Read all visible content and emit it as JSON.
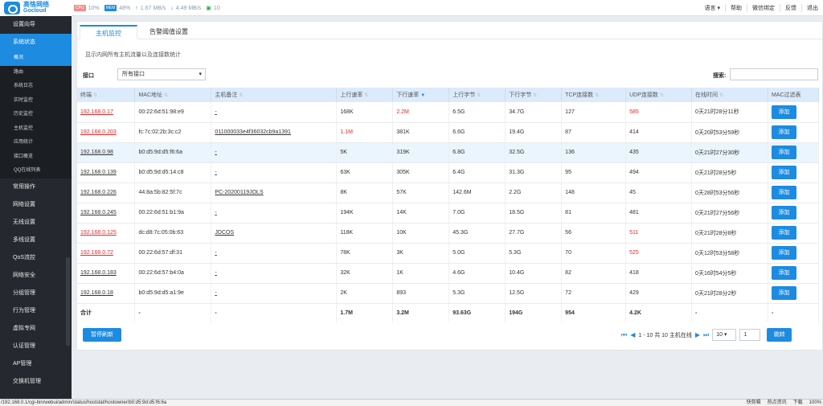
{
  "logo": {
    "cn": "高恪网络",
    "en": "Gocloud"
  },
  "stats": {
    "cpu": "10%",
    "mem": "48%",
    "up": "1.67 MB/s",
    "down": "4.49 MB/s",
    "online": "10"
  },
  "topnav": [
    "语言 ▾",
    "帮助",
    "微信绑定",
    "反馈",
    "退出"
  ],
  "sidebar": {
    "items_before": [
      "设置向导",
      "系统状态"
    ],
    "sub": [
      "概况",
      "路由",
      "系统日志",
      "实时监控",
      "历史监控",
      "主机监控",
      "应用统计",
      "接口概览",
      "QQ在线列表"
    ],
    "items_after": [
      "常用操作",
      "网络设置",
      "无线设置",
      "多线设置",
      "QoS流控",
      "网络安全",
      "分组管理",
      "行为管理",
      "虚拟专网",
      "认证管理",
      "AP管理",
      "交换机管理"
    ]
  },
  "tabs": [
    "主机监控",
    "告警阈值设置"
  ],
  "hint": "显示内网所有主机流量以及连接数统计",
  "filter": {
    "label": "接口",
    "value": "所有接口"
  },
  "search": {
    "label": "搜索:"
  },
  "columns": [
    "终端",
    "MAC地址",
    "主机备注",
    "上行速率",
    "下行速率",
    "上行字节",
    "下行字节",
    "TCP连接数",
    "UDP连接数",
    "在线时间",
    "MAC过滤表"
  ],
  "rows": [
    {
      "ip": "192.168.0.17",
      "mac": "00:22:6d:51:98:e9",
      "note": "-",
      "up": "168K",
      "down": "2.2M",
      "ub": "6.5G",
      "db": "34.7G",
      "tcp": "127",
      "udp": "585",
      "time": "0天21时28分11秒",
      "ip_red": true,
      "up_red": false,
      "down_red": true,
      "udp_red": true
    },
    {
      "ip": "192.168.0.203",
      "mac": "fc:7c:02:2b:3c:c2",
      "note": "011000033e4f36032cb9a1391",
      "up": "1.1M",
      "down": "381K",
      "ub": "6.6G",
      "db": "19.4G",
      "tcp": "87",
      "udp": "414",
      "time": "0天20时53分59秒",
      "ip_red": true,
      "up_red": true,
      "down_red": false,
      "udp_red": false
    },
    {
      "ip": "192.168.0.98",
      "mac": "b0:d5:9d:d5:f6:6a",
      "note": "-",
      "up": "5K",
      "down": "319K",
      "ub": "6.8G",
      "db": "32.5G",
      "tcp": "136",
      "udp": "435",
      "time": "0天21时27分30秒",
      "ip_red": false,
      "up_red": false,
      "down_red": false,
      "udp_red": false
    },
    {
      "ip": "192.168.0.139",
      "mac": "b0:d5:9d:d5:14:c8",
      "note": "-",
      "up": "63K",
      "down": "305K",
      "ub": "6.4G",
      "db": "31.3G",
      "tcp": "95",
      "udp": "494",
      "time": "0天21时28分5秒",
      "ip_red": false,
      "up_red": false,
      "down_red": false,
      "udp_red": false
    },
    {
      "ip": "192.168.0.226",
      "mac": "44:8a:5b:82:5f:7c",
      "note": "PC-20200119JOLS",
      "up": "8K",
      "down": "57K",
      "ub": "142.6M",
      "db": "2.2G",
      "tcp": "148",
      "udp": "45",
      "time": "0天28时53分56秒",
      "ip_red": false,
      "up_red": false,
      "down_red": false,
      "udp_red": false
    },
    {
      "ip": "192.168.0.245",
      "mac": "00:22:6d:51:b1:9a",
      "note": "-",
      "up": "194K",
      "down": "14K",
      "ub": "7.0G",
      "db": "18.5G",
      "tcp": "81",
      "udp": "481",
      "time": "0天21时27分56秒",
      "ip_red": false,
      "up_red": false,
      "down_red": false,
      "udp_red": false
    },
    {
      "ip": "192.168.0.125",
      "mac": "dc:d8:7c:05:0b:63",
      "note": "JDCOS",
      "up": "118K",
      "down": "10K",
      "ub": "45.3G",
      "db": "27.7G",
      "tcp": "56",
      "udp": "511",
      "time": "0天21时28分8秒",
      "ip_red": true,
      "up_red": false,
      "down_red": false,
      "udp_red": true
    },
    {
      "ip": "192.168.0.72",
      "mac": "00:22:6d:57:df:31",
      "note": "-",
      "up": "78K",
      "down": "3K",
      "ub": "5.0G",
      "db": "5.3G",
      "tcp": "70",
      "udp": "525",
      "time": "0天12时53分58秒",
      "ip_red": true,
      "up_red": false,
      "down_red": false,
      "udp_red": true
    },
    {
      "ip": "192.168.0.183",
      "mac": "00:22:6d:57:b4:0a",
      "note": "-",
      "up": "32K",
      "down": "1K",
      "ub": "4.6G",
      "db": "10.4G",
      "tcp": "82",
      "udp": "418",
      "time": "0天16时54分5秒",
      "ip_red": false,
      "up_red": false,
      "down_red": false,
      "udp_red": false
    },
    {
      "ip": "192.168.0.18",
      "mac": "b0:d5:9d:d5:a1:9e",
      "note": "-",
      "up": "2K",
      "down": "893",
      "ub": "5.3G",
      "db": "12.5G",
      "tcp": "72",
      "udp": "429",
      "time": "0天21时28分2秒",
      "ip_red": false,
      "up_red": false,
      "down_red": false,
      "udp_red": false
    }
  ],
  "add_label": "添加",
  "total": {
    "label": "合计",
    "mac": "-",
    "note": "-",
    "up": "1.7M",
    "down": "3.2M",
    "ub": "93.63G",
    "db": "194G",
    "tcp": "954",
    "udp": "4.2K",
    "time": "-",
    "mac_filter": "-"
  },
  "pause_label": "暂停刷新",
  "pager": {
    "info": "1 - 10 共 10 主机在线",
    "per_page": "10",
    "page": "1",
    "jump": "跳转"
  },
  "status_url": "/192.168.0.1/cgi-bin/webui/admin/status/hoststat/hostowner/b0:d5:9d:d5:f6:6a",
  "status_right": [
    "快剪辑",
    "热点资讯",
    "下载",
    "100%"
  ]
}
